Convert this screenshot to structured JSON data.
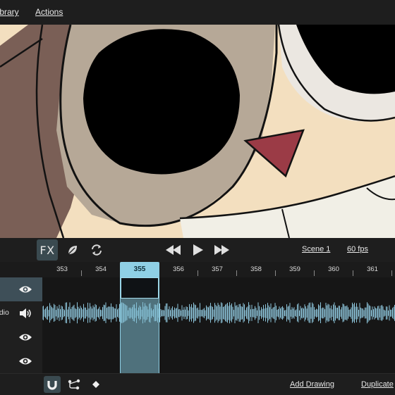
{
  "menu": {
    "library_label": "Library",
    "actions_label": "Actions"
  },
  "toolbar": {
    "fx_label": "FX",
    "scene_label": "Scene 1",
    "fps_label": "60 fps"
  },
  "timeline": {
    "frames": [
      "353",
      "354",
      "355",
      "356",
      "357",
      "358",
      "359",
      "360",
      "361"
    ],
    "current_frame": "355",
    "tracks": [
      {
        "name": "",
        "icon": "eye-icon",
        "selected": true
      },
      {
        "name": "Audio",
        "icon": "speaker-icon",
        "selected": false
      },
      {
        "name": "",
        "icon": "eye-icon",
        "selected": false
      },
      {
        "name": "",
        "icon": "eye-icon",
        "selected": false
      }
    ]
  },
  "bottombar": {
    "add_drawing_label": "Add Drawing",
    "duplicate_label": "Duplicate"
  },
  "colors": {
    "accent": "#8fd0e5",
    "waveform": "#8ec6dc",
    "panel": "#1e1e1e"
  }
}
